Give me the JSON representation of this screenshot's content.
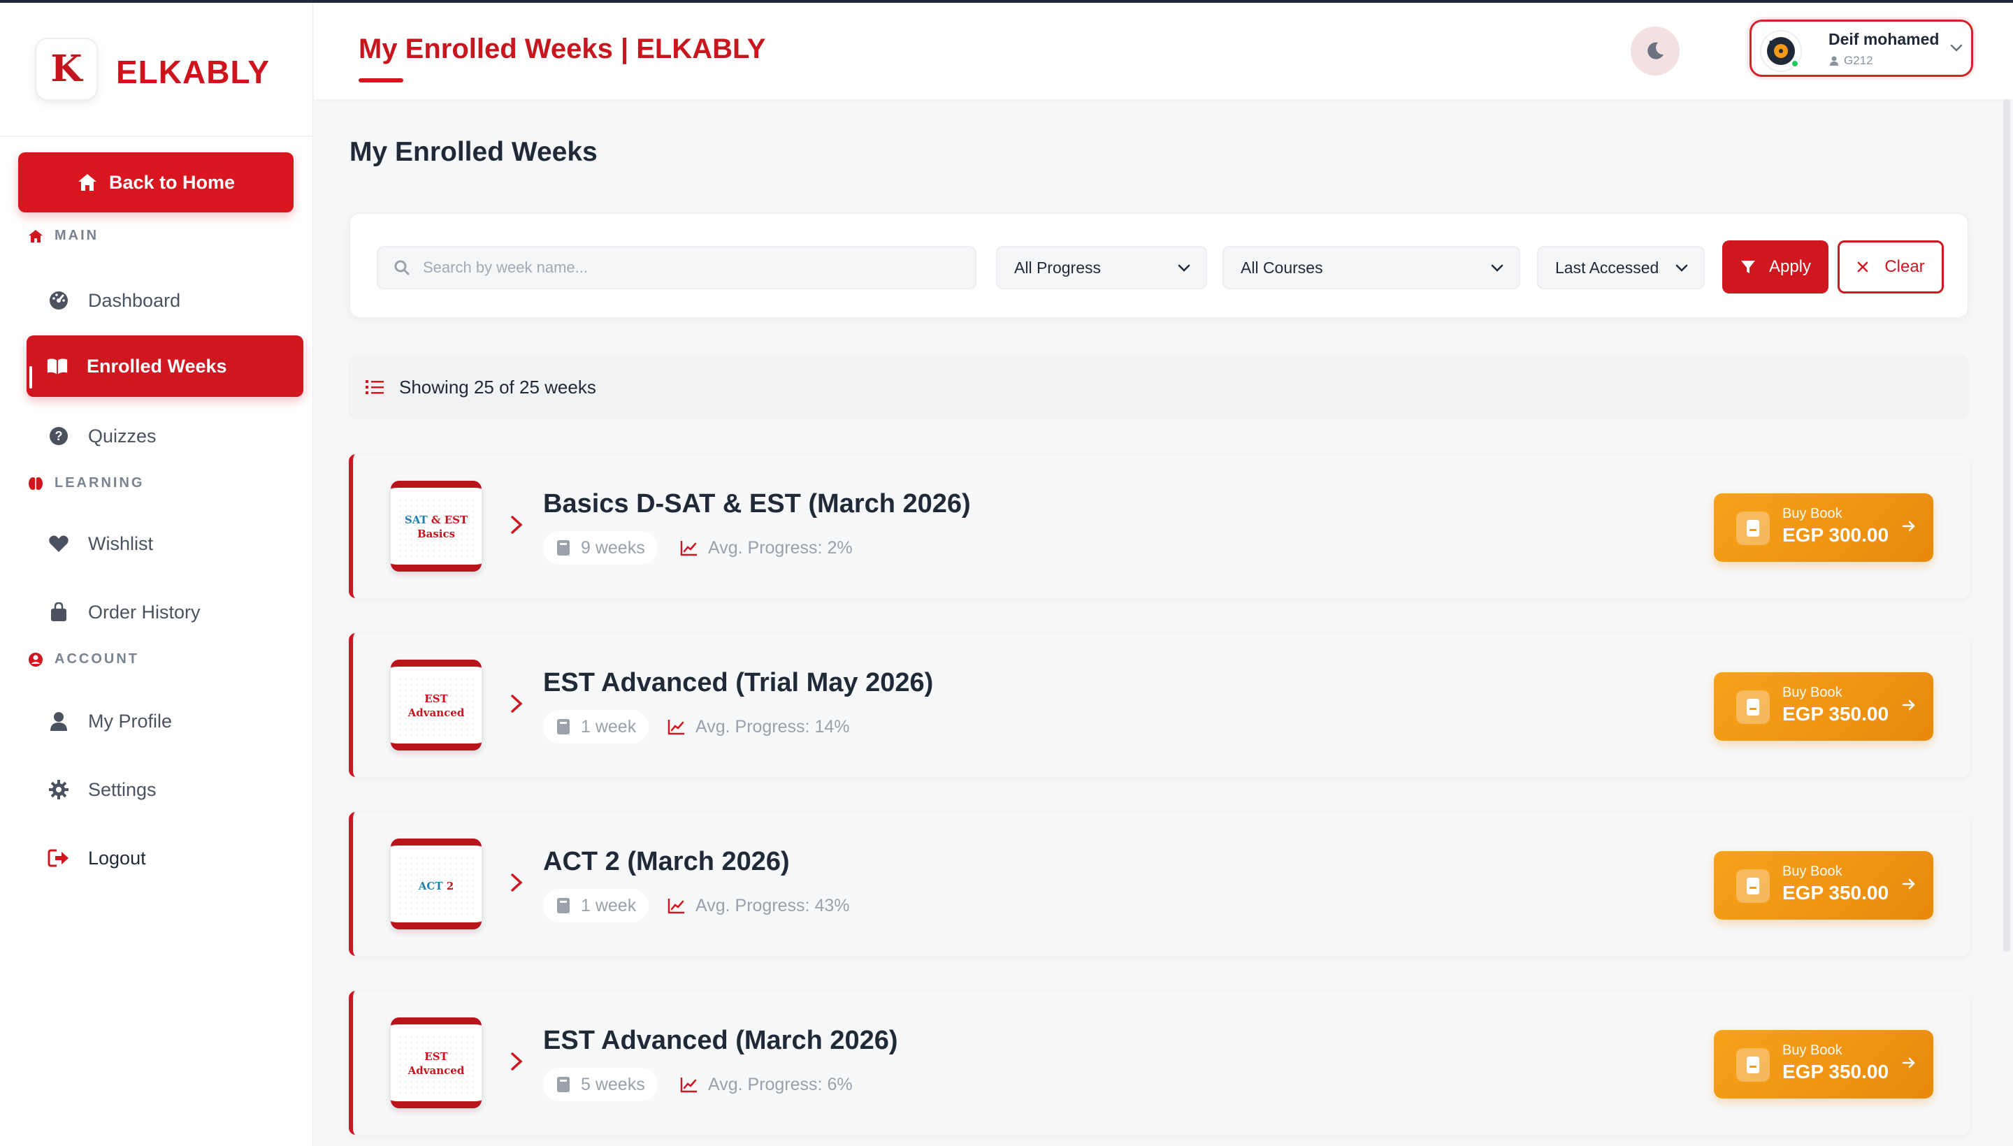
{
  "brand": {
    "name": "ELKABLY",
    "logo_letter": "K"
  },
  "sidebar": {
    "back_home": "Back to Home",
    "sections": {
      "main": "MAIN",
      "learning": "LEARNING",
      "account": "ACCOUNT"
    },
    "items": {
      "dashboard": "Dashboard",
      "enrolled_weeks": "Enrolled Weeks",
      "quizzes": "Quizzes",
      "wishlist": "Wishlist",
      "order_history": "Order History",
      "my_profile": "My Profile",
      "settings": "Settings",
      "logout": "Logout"
    },
    "active_item": "Enrolled Weeks"
  },
  "header": {
    "title": "My Enrolled Weeks | ELKABLY",
    "user": {
      "name": "Deif mohamed",
      "code": "G212"
    }
  },
  "main": {
    "title": "My Enrolled Weeks",
    "filters": {
      "search_placeholder": "Search by week name...",
      "progress": "All Progress",
      "courses": "All Courses",
      "sort": "Last Accessed",
      "apply": "Apply",
      "clear": "Clear"
    },
    "showing": "Showing 25 of 25 weeks",
    "cards": [
      {
        "title": "Basics D-SAT & EST (March 2026)",
        "thumb_a": "SAT",
        "thumb_amp": " & ",
        "thumb_b": "EST",
        "thumb_c": "Basics",
        "weeks": "9 weeks",
        "progress": "Avg. Progress: 2%",
        "buy_label": "Buy Book",
        "price": "EGP 300.00"
      },
      {
        "title": "EST Advanced (Trial May 2026)",
        "thumb_a": "",
        "thumb_amp": "",
        "thumb_b": "EST",
        "thumb_c": "Advanced",
        "weeks": "1 week",
        "progress": "Avg. Progress: 14%",
        "buy_label": "Buy Book",
        "price": "EGP 350.00"
      },
      {
        "title": "ACT 2 (March 2026)",
        "thumb_a": "ACT",
        "thumb_amp": " 2",
        "thumb_b": "",
        "thumb_c": "",
        "weeks": "1 week",
        "progress": "Avg. Progress: 43%",
        "buy_label": "Buy Book",
        "price": "EGP 350.00"
      },
      {
        "title": "EST Advanced (March 2026)",
        "thumb_a": "",
        "thumb_amp": "",
        "thumb_b": "EST",
        "thumb_c": "Advanced",
        "weeks": "5 weeks",
        "progress": "Avg. Progress: 6%",
        "buy_label": "Buy Book",
        "price": "EGP 350.00"
      }
    ]
  },
  "colors": {
    "brand_red": "#d0161f",
    "buy_orange": "#f39a16",
    "text_dark": "#1f2937",
    "muted": "#9aa1ab"
  }
}
